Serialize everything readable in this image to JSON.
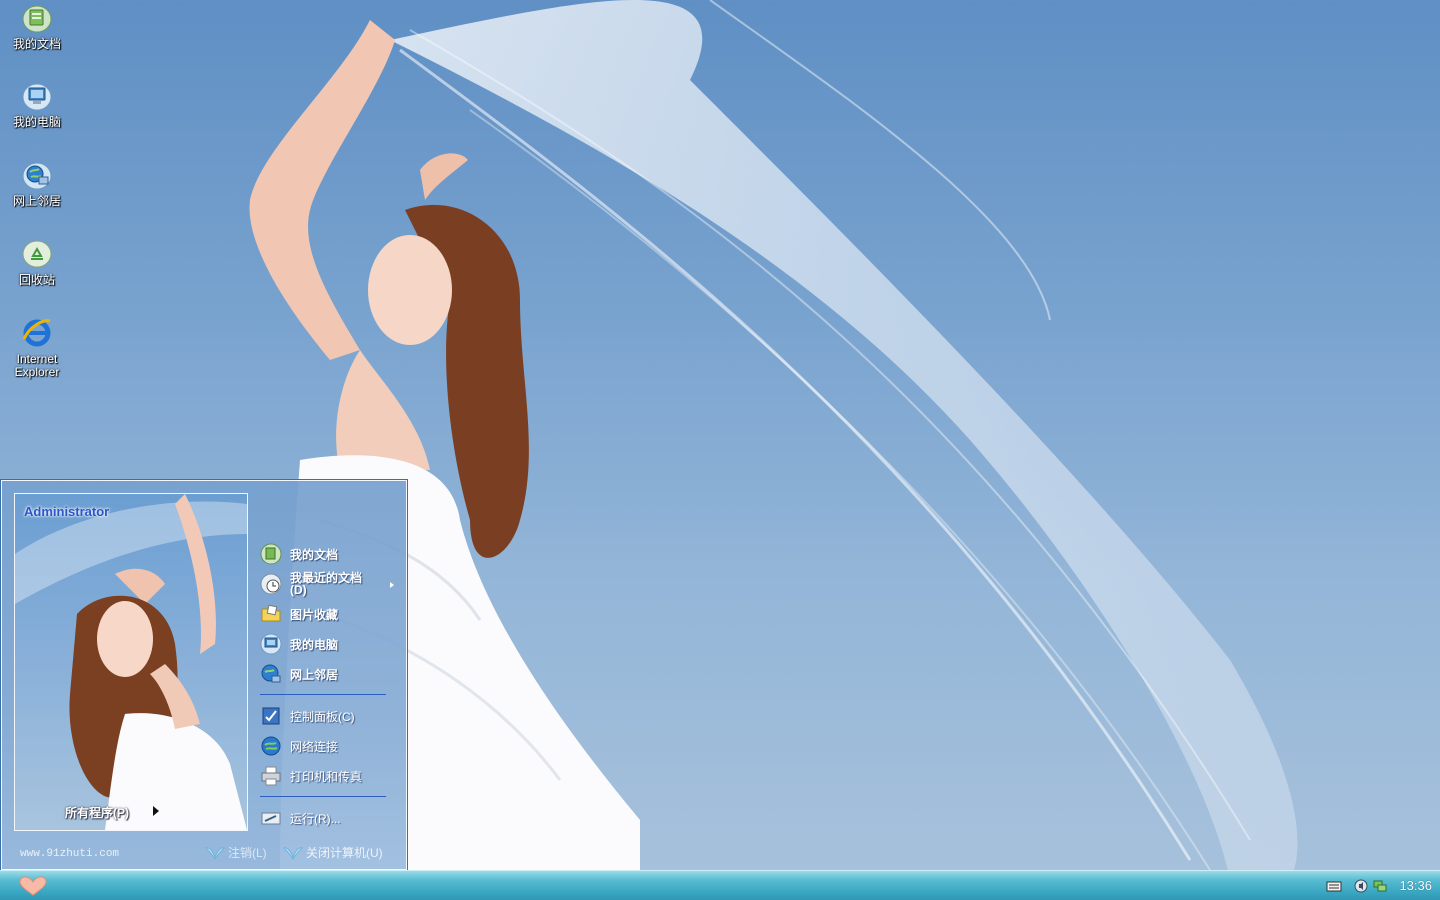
{
  "desktop": {
    "icons": [
      {
        "label": "我的文档",
        "icon": "my-documents-icon"
      },
      {
        "label": "我的电脑",
        "icon": "my-computer-icon"
      },
      {
        "label": "网上邻居",
        "icon": "network-places-icon"
      },
      {
        "label": "回收站",
        "icon": "recycle-bin-icon"
      },
      {
        "label_line1": "Internet",
        "label_line2": "Explorer",
        "icon": "internet-explorer-icon"
      }
    ]
  },
  "start_menu": {
    "user_name": "Administrator",
    "all_programs": "所有程序(P)",
    "items_top": [
      {
        "label": "我的文档",
        "icon": "my-documents-icon"
      },
      {
        "label_line1": "我最近的文档",
        "label_line2": "(D)",
        "icon": "recent-documents-icon",
        "has_submenu": true
      },
      {
        "label": "图片收藏",
        "icon": "my-pictures-icon"
      },
      {
        "label": "我的电脑",
        "icon": "my-computer-icon"
      },
      {
        "label": "网上邻居",
        "icon": "network-places-icon"
      }
    ],
    "items_mid": [
      {
        "label": "控制面板(C)",
        "icon": "control-panel-icon"
      },
      {
        "label": "网络连接",
        "icon": "network-connections-icon"
      },
      {
        "label": "打印机和传真",
        "icon": "printer-icon"
      }
    ],
    "run": {
      "label": "运行(R)...",
      "icon": "run-icon"
    },
    "footer": {
      "url": "www.91zhuti.com",
      "logoff": "注销(L)",
      "shutdown": "关闭计算机(U)"
    }
  },
  "taskbar": {
    "start_icon": "heart-start-icon",
    "tray_icons": [
      "keyboard-icon",
      "volume-icon",
      "network-status-icon"
    ],
    "clock": "13:36"
  },
  "colors": {
    "taskbar": "#3aa7c2",
    "start_menu_bg": "#7ea7d4",
    "user_name": "#2c55c8"
  }
}
